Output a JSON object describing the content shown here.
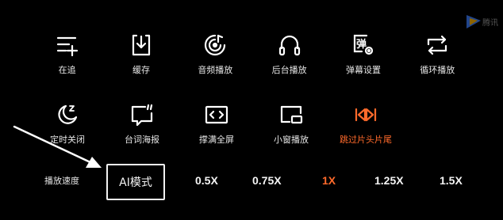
{
  "menu": {
    "row1": [
      {
        "id": "follow",
        "label": "在追",
        "icon": "add-to-list-icon"
      },
      {
        "id": "cache",
        "label": "缓存",
        "icon": "download-icon"
      },
      {
        "id": "audio",
        "label": "音频播放",
        "icon": "audio-disc-icon"
      },
      {
        "id": "background",
        "label": "后台播放",
        "icon": "headphones-icon"
      },
      {
        "id": "danmaku",
        "label": "弹幕设置",
        "icon": "danmaku-settings-icon"
      },
      {
        "id": "loop",
        "label": "循环播放",
        "icon": "loop-icon"
      }
    ],
    "row2": [
      {
        "id": "timer",
        "label": "定时关闭",
        "icon": "moon-sleep-icon"
      },
      {
        "id": "quote",
        "label": "台词海报",
        "icon": "quote-bubble-icon"
      },
      {
        "id": "fullscreen",
        "label": "撑满全屏",
        "icon": "fill-screen-icon"
      },
      {
        "id": "pip",
        "label": "小窗播放",
        "icon": "picture-in-picture-icon"
      },
      {
        "id": "skip",
        "label": "跳过片头片尾",
        "icon": "skip-intro-outro-icon"
      }
    ]
  },
  "speed": {
    "title": "播放速度",
    "options": [
      "AI模式",
      "0.5X",
      "0.75X",
      "1X",
      "1.25X",
      "1.5X"
    ],
    "active": "1X",
    "boxed": "AI模式"
  },
  "colors": {
    "background": "#000000",
    "text": "#e6e6e6",
    "accent": "#ff6a2b"
  },
  "watermark": {
    "text": "腾讯",
    "icon": "tencent-video-logo"
  }
}
